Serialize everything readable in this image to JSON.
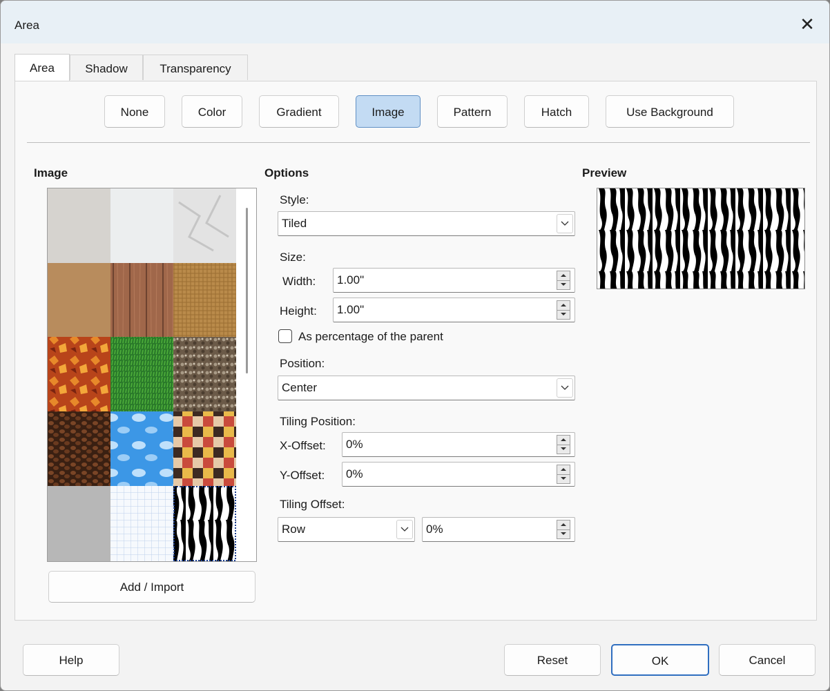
{
  "window": {
    "title": "Area"
  },
  "tabs": [
    {
      "label": "Area"
    },
    {
      "label": "Shadow"
    },
    {
      "label": "Transparency"
    }
  ],
  "fill_types": {
    "none": "None",
    "color": "Color",
    "gradient": "Gradient",
    "image": "Image",
    "pattern": "Pattern",
    "hatch": "Hatch",
    "use_background": "Use Background",
    "selected": "Image"
  },
  "image_section": {
    "heading": "Image",
    "add_import_label": "Add / Import",
    "tiles": [
      "concrete-light",
      "paper-white",
      "crumpled-paper",
      "cardboard",
      "wood-planks",
      "burlap",
      "autumn-leaves",
      "grass",
      "pebbles",
      "coffee-beans",
      "sky-clouds",
      "color-mosaic",
      "concrete-gray",
      "grid-paper",
      "zebra"
    ],
    "selected_tile": "zebra"
  },
  "options": {
    "heading": "Options",
    "style_label": "Style:",
    "style_value": "Tiled",
    "size_label": "Size:",
    "width_label": "Width:",
    "width_value": "1.00\"",
    "height_label": "Height:",
    "height_value": "1.00\"",
    "percentage_label": "As percentage of the parent",
    "percentage_checked": false,
    "position_label": "Position:",
    "position_value": "Center",
    "tiling_position_label": "Tiling Position:",
    "x_offset_label": "X-Offset:",
    "x_offset_value": "0%",
    "y_offset_label": "Y-Offset:",
    "y_offset_value": "0%",
    "tiling_offset_label": "Tiling Offset:",
    "tiling_offset_mode": "Row",
    "tiling_offset_value": "0%"
  },
  "preview": {
    "heading": "Preview"
  },
  "footer": {
    "help_label": "Help",
    "reset_label": "Reset",
    "ok_label": "OK",
    "cancel_label": "Cancel"
  },
  "colors": {
    "selected_button": "#c3dbf3",
    "accent_border": "#5f8fc4",
    "titlebar": "#e8f0f6"
  }
}
